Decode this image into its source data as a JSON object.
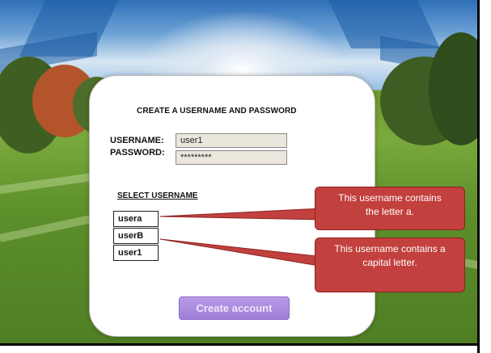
{
  "form": {
    "title": "CREATE A USERNAME AND PASSWORD",
    "username_label": "USERNAME:",
    "username_value": "user1",
    "password_label": "PASSWORD:",
    "password_value": "*********"
  },
  "selection": {
    "title": "SELECT USERNAME",
    "options": [
      "usera",
      "userB",
      "user1"
    ]
  },
  "callouts": [
    "This username contains the letter a.",
    "This username contains a capital letter."
  ],
  "actions": {
    "create_label": "Create account"
  },
  "colors": {
    "callout_fill": "#c2403d",
    "button_fill": "#a98ade"
  }
}
